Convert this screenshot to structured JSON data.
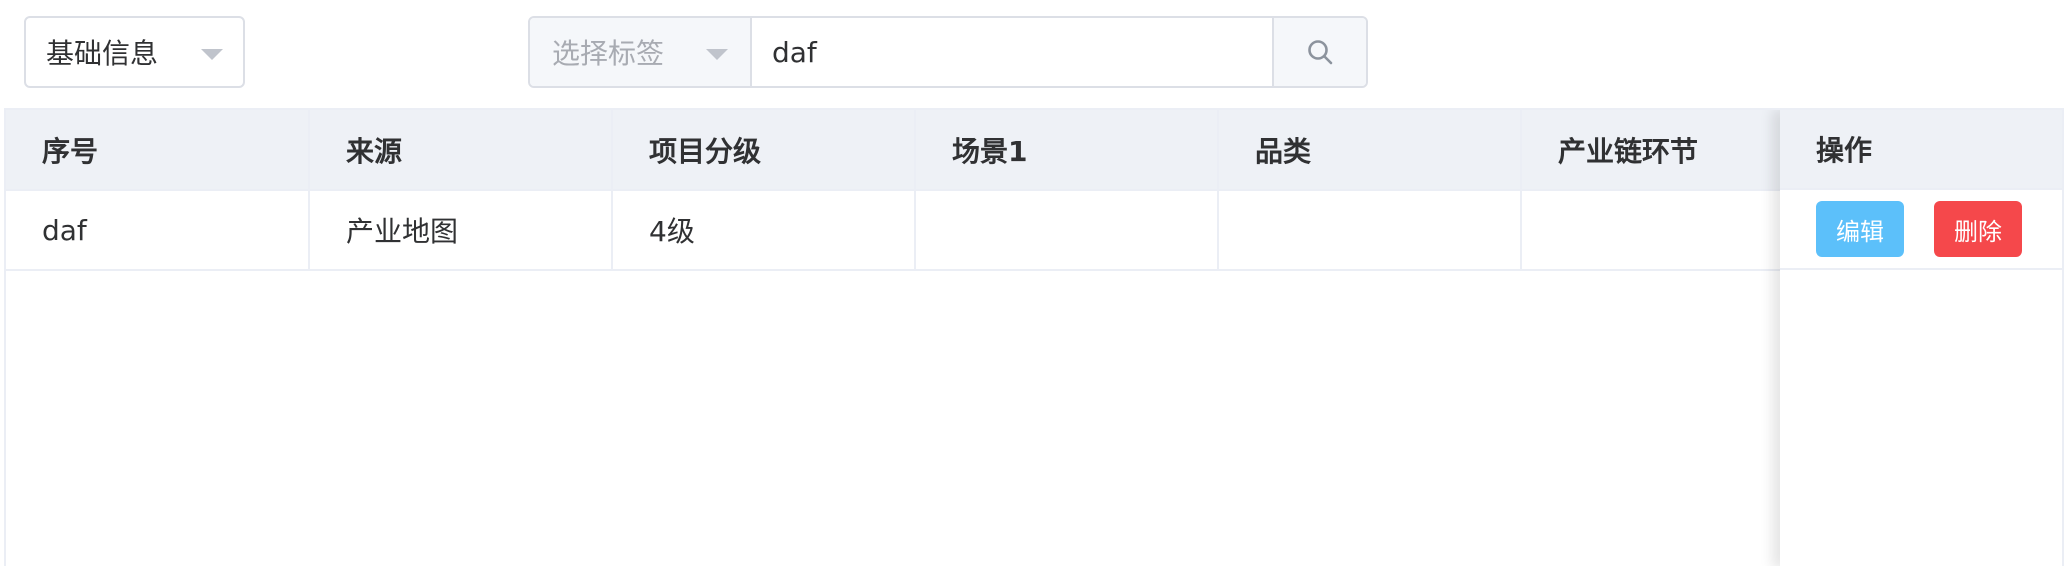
{
  "toolbar": {
    "category_select": {
      "value": "基础信息"
    },
    "tag_select": {
      "placeholder": "选择标签"
    },
    "search": {
      "value": "daf"
    }
  },
  "table": {
    "columns": [
      "序号",
      "来源",
      "项目分级",
      "场景1",
      "品类",
      "产业链环节"
    ],
    "action_column": "操作",
    "rows": [
      {
        "cells": [
          "daf",
          "产业地图",
          "4级",
          "",
          "",
          ""
        ]
      }
    ],
    "actions": {
      "edit": "编辑",
      "delete": "删除"
    }
  },
  "colors": {
    "edit_button": "#5cc0fa",
    "delete_button": "#f5484b",
    "header_bg": "#eef1f6",
    "border": "#dcdfe6"
  },
  "icons": [
    "chevron-down-icon",
    "search-icon"
  ]
}
